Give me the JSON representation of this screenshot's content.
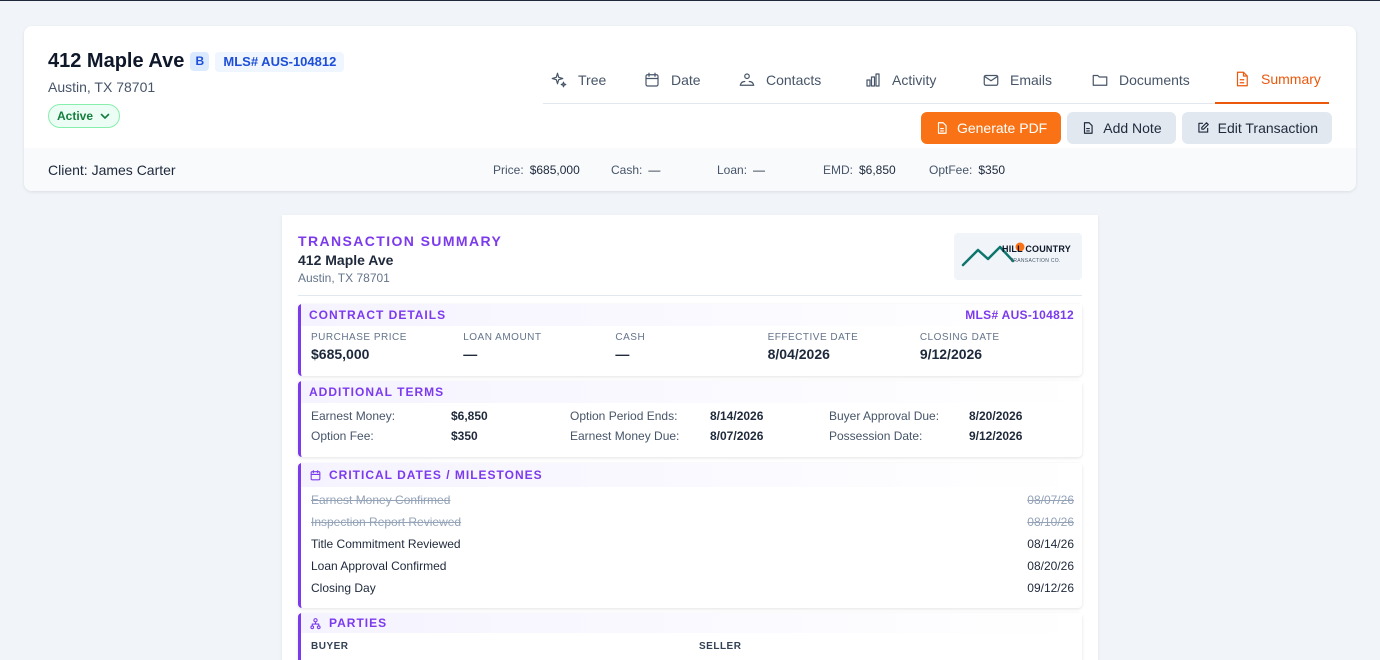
{
  "property": {
    "address": "412 Maple Ave",
    "badge": "B",
    "mls": "MLS# AUS-104812",
    "city": "Austin, TX 78701",
    "status": "Active"
  },
  "tabs": [
    {
      "label": "Tree",
      "icon": "sparkle-icon"
    },
    {
      "label": "Date",
      "icon": "calendar-icon"
    },
    {
      "label": "Contacts",
      "icon": "contacts-icon"
    },
    {
      "label": "Activity",
      "icon": "bar-chart-icon"
    },
    {
      "label": "Emails",
      "icon": "mail-icon"
    },
    {
      "label": "Documents",
      "icon": "folder-icon"
    },
    {
      "label": "Summary",
      "icon": "document-icon",
      "active": true
    }
  ],
  "actions": {
    "generate_pdf": "Generate PDF",
    "add_note": "Add Note",
    "edit_transaction": "Edit Transaction"
  },
  "summary_bar": {
    "client": "Client: James Carter",
    "price_label": "Price:",
    "price": "$685,000",
    "cash_label": "Cash:",
    "cash": "—",
    "loan_label": "Loan:",
    "loan": "—",
    "emd_label": "EMD:",
    "emd": "$6,850",
    "optfee_label": "OptFee:",
    "optfee": "$350"
  },
  "doc": {
    "kicker": "TRANSACTION SUMMARY",
    "address": "412 Maple Ave",
    "city": "Austin, TX 78701",
    "logo_name": "HILL COUNTRY",
    "logo_sub": "TRANSACTION CO."
  },
  "contract": {
    "title": "CONTRACT DETAILS",
    "mls": "MLS# AUS-104812",
    "fields": [
      {
        "label": "PURCHASE PRICE",
        "value": "$685,000"
      },
      {
        "label": "LOAN AMOUNT",
        "value": "—"
      },
      {
        "label": "CASH",
        "value": "—"
      },
      {
        "label": "EFFECTIVE DATE",
        "value": "8/04/2026"
      },
      {
        "label": "CLOSING DATE",
        "value": "9/12/2026"
      }
    ]
  },
  "terms": {
    "title": "ADDITIONAL TERMS",
    "rows": [
      [
        {
          "k": "Earnest Money:",
          "v": "$6,850"
        },
        {
          "k": "Option Period Ends:",
          "v": "8/14/2026"
        },
        {
          "k": "Buyer Approval Due:",
          "v": "8/20/2026"
        }
      ],
      [
        {
          "k": "Option Fee:",
          "v": "$350"
        },
        {
          "k": "Earnest Money Due:",
          "v": "8/07/2026"
        },
        {
          "k": "Possession Date:",
          "v": "9/12/2026"
        }
      ]
    ]
  },
  "milestones": {
    "title": "CRITICAL DATES / MILESTONES",
    "items": [
      {
        "label": "Earnest Money Confirmed",
        "date": "08/07/26",
        "done": true
      },
      {
        "label": "Inspection Report Reviewed",
        "date": "08/10/26",
        "done": true
      },
      {
        "label": "Title Commitment Reviewed",
        "date": "08/14/26",
        "done": false
      },
      {
        "label": "Loan Approval Confirmed",
        "date": "08/20/26",
        "done": false
      },
      {
        "label": "Closing Day",
        "date": "09/12/26",
        "done": false
      }
    ]
  },
  "parties": {
    "title": "PARTIES",
    "buyer_label": "BUYER",
    "seller_label": "SELLER"
  },
  "colors": {
    "accent_orange": "#f97316",
    "accent_purple": "#7c3aed",
    "status_green": "#15803d"
  }
}
